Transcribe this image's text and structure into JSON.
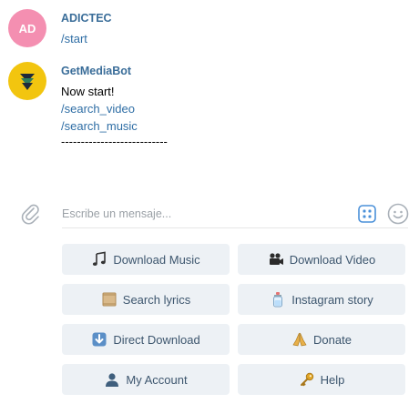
{
  "messages": [
    {
      "avatar_initials": "AD",
      "avatar_color": "#f48fb1",
      "sender": "ADICTEC",
      "lines": [
        "/start"
      ]
    },
    {
      "avatar_icon": "getmediabot-logo-icon",
      "avatar_color": "#f2c50f",
      "sender": "GetMediaBot",
      "lines": [
        "Now start!",
        "/search_video",
        "/search_music",
        "---------------------------"
      ]
    }
  ],
  "composer": {
    "placeholder": "Escribe un mensaje...",
    "attach_icon": "paperclip-icon",
    "keyboard_icon": "bot-keyboard-icon",
    "emoji_icon": "smiley-icon"
  },
  "keyboard": {
    "buttons": [
      {
        "label": "Download Music",
        "icon": "musical-notes-icon"
      },
      {
        "label": "Download Video",
        "icon": "movie-camera-icon"
      },
      {
        "label": "Search lyrics",
        "icon": "scroll-icon"
      },
      {
        "label": "Instagram story",
        "icon": "baby-bottle-icon"
      },
      {
        "label": "Direct Download",
        "icon": "down-arrow-icon"
      },
      {
        "label": "Donate",
        "icon": "folded-hands-icon"
      },
      {
        "label": "My Account",
        "icon": "bust-silhouette-icon"
      },
      {
        "label": "Help",
        "icon": "key-icon"
      }
    ]
  },
  "colors": {
    "sender": "#3a6d99",
    "command_link": "#2f6ea5",
    "button_bg": "#edf1f5",
    "button_text": "#3d566e",
    "accent": "#4a90d9"
  }
}
